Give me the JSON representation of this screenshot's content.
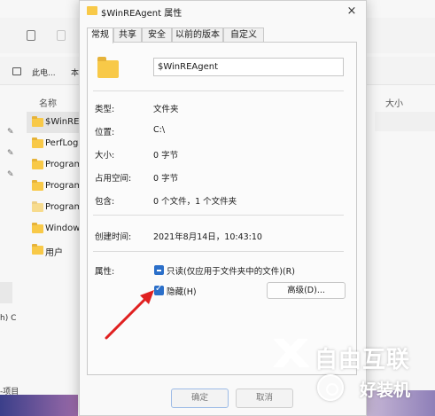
{
  "explorer": {
    "breadcrumb": [
      "此电...",
      "本"
    ],
    "column_name": "名称",
    "column_size": "大小",
    "items": [
      "$WinREA",
      "PerfLogs",
      "Program",
      "Program",
      "Program",
      "Window",
      "用户"
    ],
    "drive_label": "h) C",
    "status_text": "-项目"
  },
  "dialog": {
    "title": "$WinREAgent 属性",
    "close_icon": "×",
    "tabs": [
      "常规",
      "共享",
      "安全",
      "以前的版本",
      "自定义"
    ],
    "folder_name": "$WinREAgent",
    "fields": [
      {
        "label": "类型:",
        "value": "文件夹"
      },
      {
        "label": "位置:",
        "value": "C:\\"
      },
      {
        "label": "大小:",
        "value": "0 字节"
      },
      {
        "label": "占用空间:",
        "value": "0 字节"
      },
      {
        "label": "包含:",
        "value": "0 个文件，1 个文件夹"
      }
    ],
    "created": {
      "label": "创建时间:",
      "value": "2021年8月14日，10:43:10"
    },
    "attributes": {
      "label": "属性:",
      "readonly_label": "只读(仅应用于文件夹中的文件)(R)",
      "hidden_label": "隐藏(H)",
      "advanced_button": "高级(D)..."
    },
    "ok_button": "确定",
    "cancel_button": "取消"
  },
  "watermark": {
    "text1": "自由互联",
    "text2": "好装机"
  },
  "colors": {
    "folder": "#f8c948",
    "checkbox": "#2b6fc9",
    "arrow": "#e02020"
  }
}
